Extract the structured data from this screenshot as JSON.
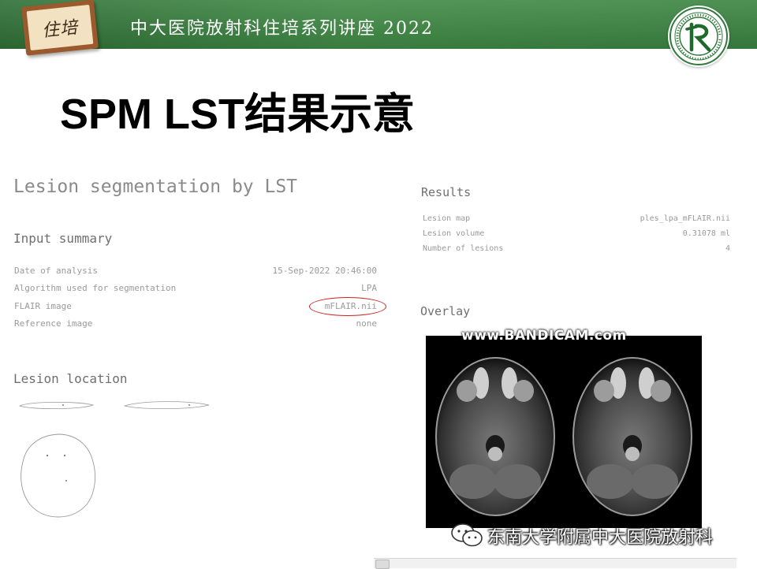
{
  "banner": {
    "board_text": "住培",
    "title": "中大医院放射科住培系列讲座 2022"
  },
  "slide": {
    "title": "SPM LST结果示意"
  },
  "report": {
    "title": "Lesion segmentation by LST",
    "input_summary": {
      "heading": "Input summary",
      "rows": [
        {
          "label": "Date of analysis",
          "value": "15-Sep-2022 20:46:00"
        },
        {
          "label": "Algorithm used for segmentation",
          "value": "LPA"
        },
        {
          "label": "FLAIR image",
          "value": "mFLAIR.nii"
        },
        {
          "label": "Reference image",
          "value": "none"
        }
      ]
    },
    "lesion_location": {
      "heading": "Lesion location"
    },
    "results": {
      "heading": "Results",
      "rows": [
        {
          "label": "Lesion map",
          "value": "ples_lpa_mFLAIR.nii"
        },
        {
          "label": "Lesion volume",
          "value": "0.31078 ml"
        },
        {
          "label": "Number of lesions",
          "value": "4"
        }
      ]
    },
    "overlay": {
      "heading": "Overlay",
      "watermark": "www.BANDICAM.com"
    }
  },
  "watermark": {
    "source": "东南大学附属中大医院放射科"
  },
  "colors": {
    "banner_green": "#3f8a45",
    "highlight_red": "#d02020"
  }
}
